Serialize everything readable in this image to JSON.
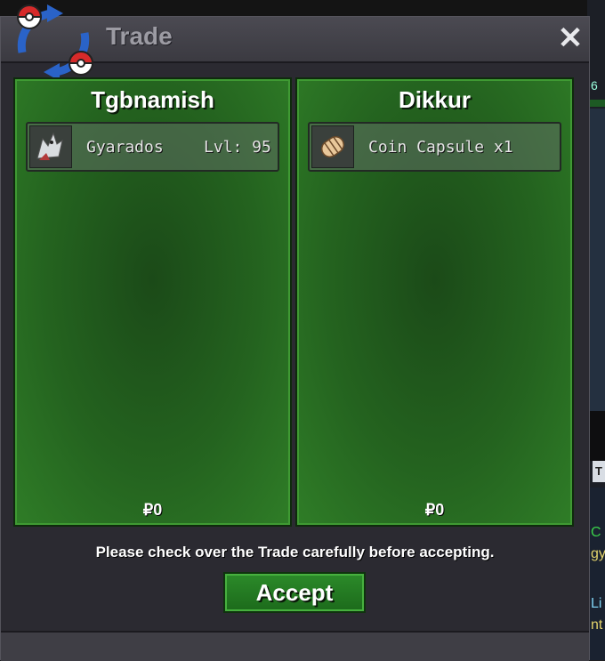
{
  "window": {
    "title": "Trade",
    "close_label": "✕"
  },
  "left_panel": {
    "player": "Tgbnamish",
    "item": {
      "name": "Gyarados",
      "level": "Lvl: 95"
    },
    "money": "₽0"
  },
  "right_panel": {
    "player": "Dikkur",
    "item": {
      "name": "Coin Capsule  x1"
    },
    "money": "₽0"
  },
  "notice": "Please check over the Trade carefully before accepting.",
  "accept_label": "Accept",
  "background": {
    "number_fragment": "6",
    "tab_fragment": "T",
    "chat_lines": [
      "C",
      "gy",
      "Li",
      "nt"
    ]
  },
  "colors": {
    "panel_green": "#24631f",
    "accept_green": "#2c8b2a",
    "title_gray": "#9c9ba3"
  }
}
